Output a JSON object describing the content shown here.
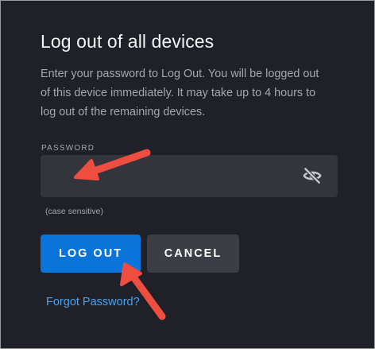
{
  "dialog": {
    "title": "Log out of all devices",
    "description_lines": [
      "Enter your password to Log Out. You will be logged out",
      "of this device immediately. It may take up to 4 hours to",
      "log out of the remaining devices."
    ],
    "password_label": "PASSWORD",
    "password_value": "",
    "password_hint": "(case sensitive)",
    "toggle_icon": "eye-slash-icon",
    "logout_label": "LOG OUT",
    "cancel_label": "CANCEL",
    "forgot_label": "Forgot Password?"
  },
  "colors": {
    "background": "#1f2028",
    "input": "#33343c",
    "primary": "#0a74da",
    "secondary": "#3d3e45",
    "link": "#4aa3f2",
    "annotation": "#ee4e3f"
  }
}
